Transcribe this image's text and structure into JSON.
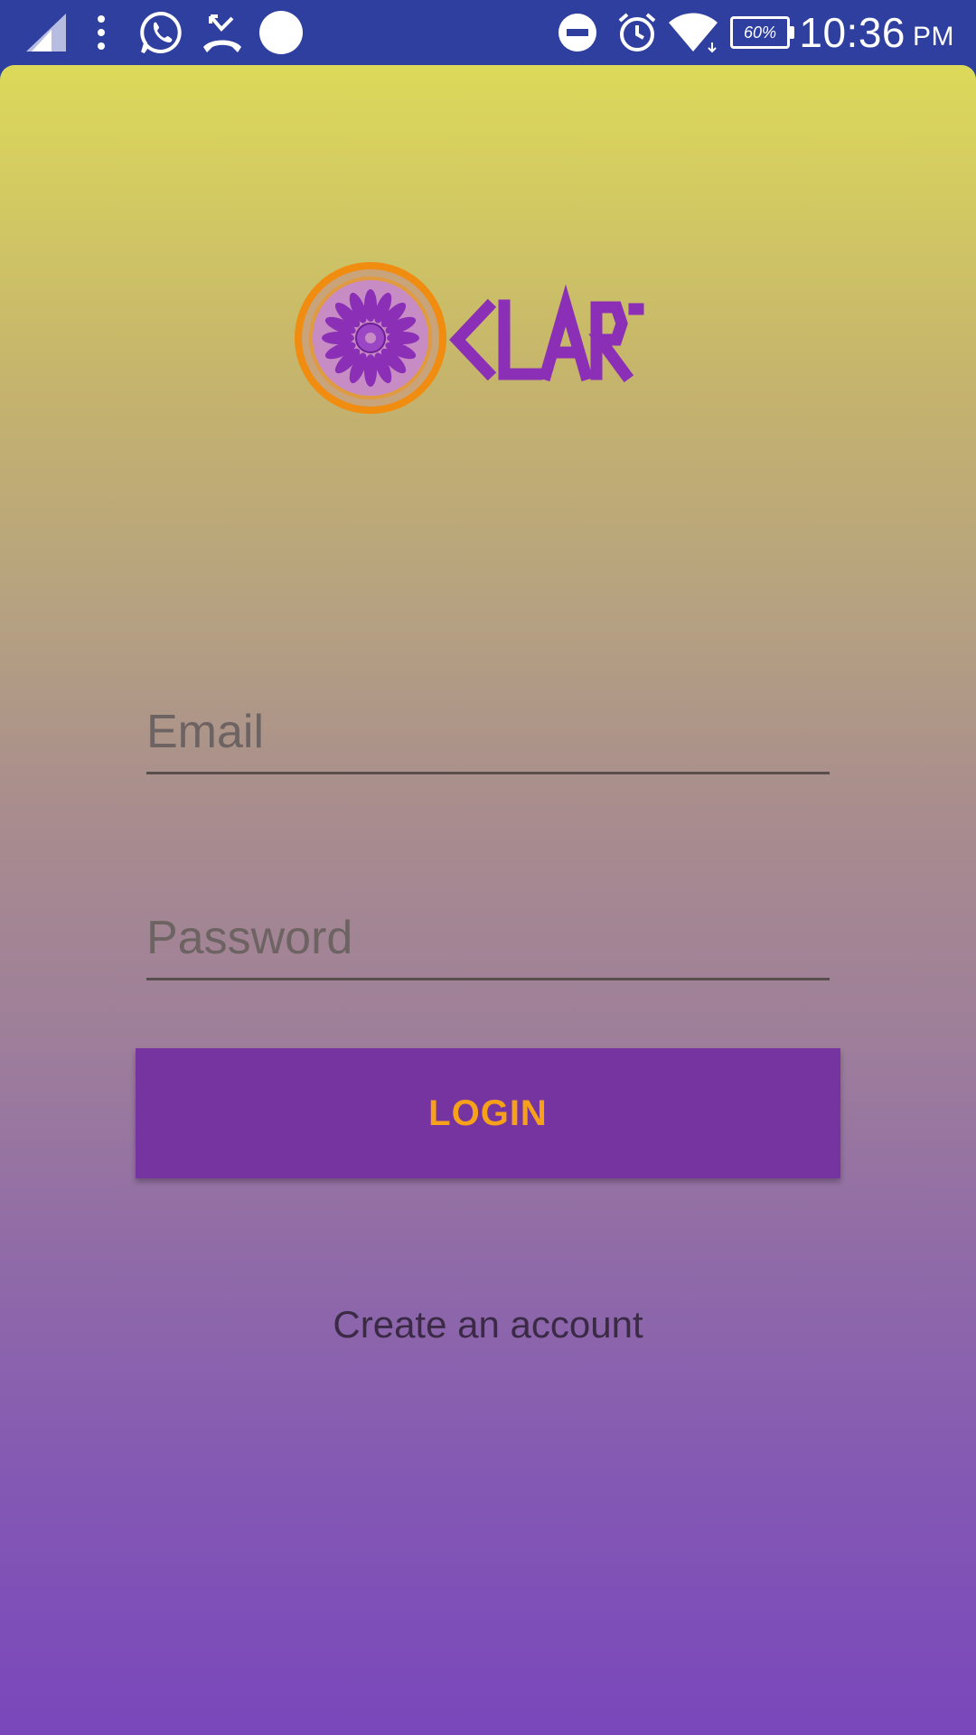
{
  "status_bar": {
    "time": "10:36",
    "ampm": "PM",
    "battery_percent_label": "60%",
    "background_color": "#2f3f9f",
    "icons": [
      "signal-icon",
      "overflow-dots-icon",
      "whatsapp-icon",
      "missed-call-icon",
      "notification-dot-icon",
      "do-not-disturb-icon",
      "alarm-icon",
      "wifi-icon",
      "battery-icon"
    ]
  },
  "brand": {
    "logo_text": "CLARO",
    "logo_icon": "sun-flower-emblem",
    "text_color": "#8a2fb6",
    "ring_color": "#f08c10"
  },
  "form": {
    "email_placeholder": "Email",
    "email_value": "",
    "password_placeholder": "Password",
    "password_value": "",
    "login_label": "LOGIN",
    "login_bg_color": "#7634a0",
    "login_text_color": "#f7a01a",
    "create_account_label": "Create an account"
  },
  "theme": {
    "gradient_top": "#dcd95a",
    "gradient_bottom": "#7a47bb"
  }
}
